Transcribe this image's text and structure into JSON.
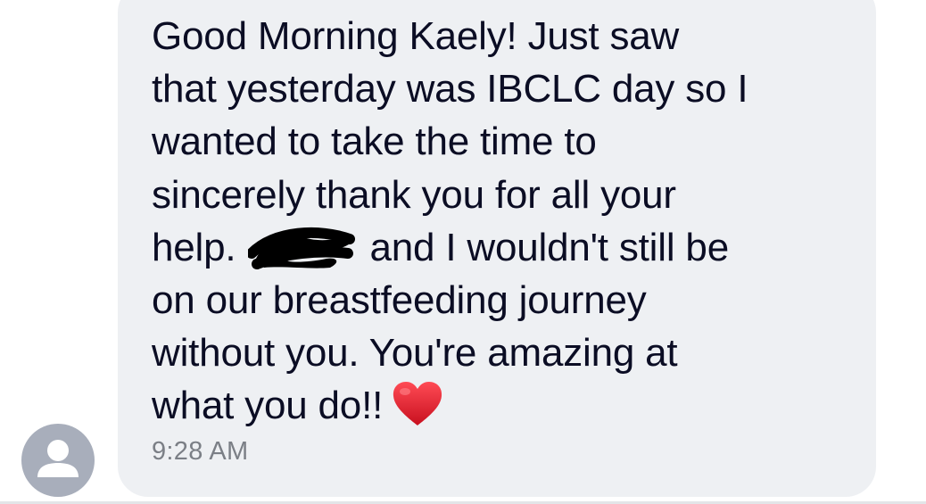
{
  "message": {
    "lines": [
      "Good Morning Kaely! Just saw",
      "that yesterday was IBCLC day so I",
      "wanted to take the time to",
      "sincerely thank you for all your",
      "help.",
      "and I wouldn't still be",
      "on our breastfeeding journey",
      "without you. You're amazing at",
      "what you do!!"
    ],
    "emoji": "red-heart-emoji",
    "redacted_name_marker": "scribbled-out-name"
  },
  "timestamp": "9:28 AM",
  "avatar": {
    "icon": "person-icon",
    "color": "#a8aebb"
  },
  "colors": {
    "bubble": "#eef0f3",
    "text": "#0b0d24",
    "timestamp": "#7b7f86",
    "heart": "#e0162b"
  }
}
